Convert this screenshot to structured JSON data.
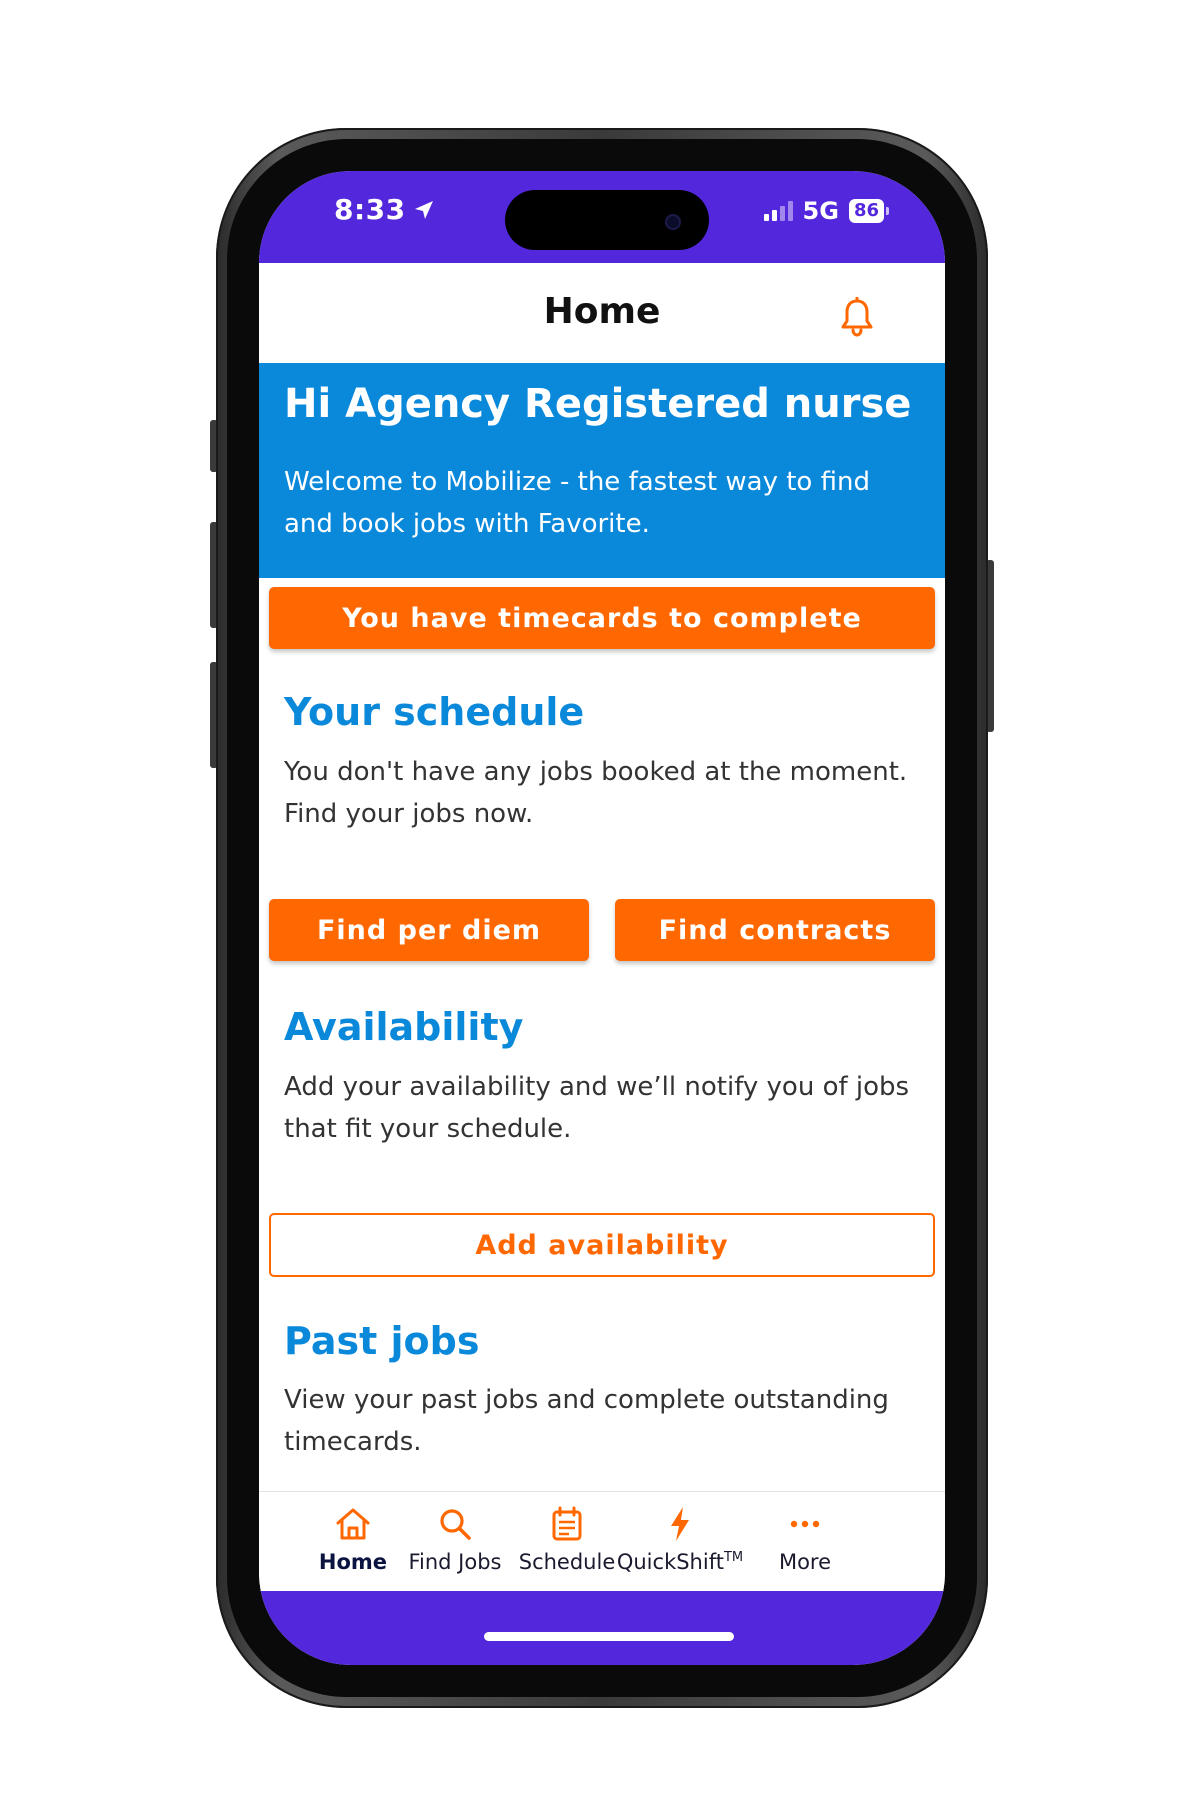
{
  "status_bar": {
    "time": "8:33",
    "network": "5G",
    "battery": "86",
    "location_icon": "location-arrow-icon",
    "signal_icon": "signal-bars-icon"
  },
  "nav": {
    "title": "Home",
    "bell_icon": "bell-icon"
  },
  "hero": {
    "greeting": "Hi Agency Registered nurse",
    "welcome": "Welcome to Mobilize - the fastest way to find and book jobs with Favorite."
  },
  "timecards_button": "You have timecards to complete",
  "schedule": {
    "title": "Your schedule",
    "text": "You don't have any jobs booked at the moment. Find your jobs now.",
    "find_per_diem": "Find per diem",
    "find_contracts": "Find contracts"
  },
  "availability": {
    "title": "Availability",
    "text": "Add your availability and we’ll notify you of jobs that fit your schedule.",
    "add_button": "Add availability"
  },
  "past_jobs": {
    "title": "Past jobs",
    "text": "View your past jobs and complete outstanding timecards."
  },
  "tabs": [
    {
      "label": "Home",
      "icon": "home-icon",
      "active": true
    },
    {
      "label": "Find Jobs",
      "icon": "search-icon",
      "active": false
    },
    {
      "label": "Schedule",
      "icon": "schedule-icon",
      "active": false
    },
    {
      "label": "QuickShift",
      "sup": "TM",
      "icon": "lightning-icon",
      "active": false
    },
    {
      "label": "More",
      "icon": "more-dots-icon",
      "active": false
    }
  ],
  "colors": {
    "status_purple": "#5327DC",
    "hero_blue": "#0A88DA",
    "accent_orange": "#FF6700"
  }
}
